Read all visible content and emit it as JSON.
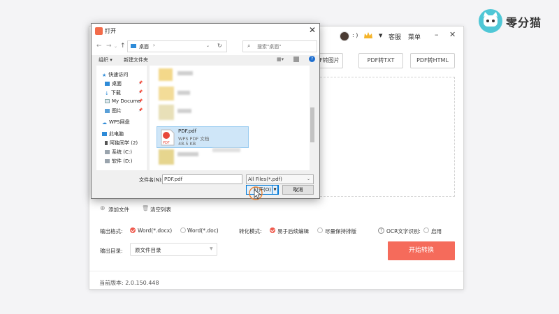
{
  "brand": {
    "name": "零分猫"
  },
  "app": {
    "user_smile": ": )",
    "support_label": "客服",
    "menu_label": "菜单",
    "formats": [
      "PDF转图片",
      "PDF转TXT",
      "PDF转HTML"
    ],
    "add_file_label": "添加文件",
    "clear_list_label": "清空列表",
    "output_format_label": "输出格式:",
    "output_formats": [
      {
        "label": "Word(*.docx)",
        "checked": true
      },
      {
        "label": "Word(*.doc)",
        "checked": false
      }
    ],
    "convert_mode_label": "转化模式:",
    "convert_modes": [
      {
        "label": "易于后续编辑",
        "checked": true
      },
      {
        "label": "尽量保持排版",
        "checked": false
      }
    ],
    "ocr_label": "OCR文字识别:",
    "ocr_option": "启用",
    "output_dir_label": "输出目录:",
    "output_dir_value": "原文件目录",
    "start_label": "开始转换",
    "version": "当前版本: 2.0.150.448",
    "accent": "#f56b5b"
  },
  "dialog": {
    "title": "打开",
    "address": "桌面",
    "search_placeholder": "搜索\"桌面\"",
    "organize": "组织 ▾",
    "new_folder": "新建文件夹",
    "tree": [
      {
        "label": "快速访问",
        "icon": "star-icon"
      },
      {
        "label": "桌面",
        "icon": "desktop-icon"
      },
      {
        "label": "下载",
        "icon": "download-icon"
      },
      {
        "label": "My Docume",
        "icon": "document-icon"
      },
      {
        "label": "图片",
        "icon": "picture-icon"
      },
      {
        "label": "WPS网盘",
        "icon": "cloud-icon"
      },
      {
        "label": "此电脑",
        "icon": "computer-icon"
      },
      {
        "label": "阿独同学 (2)",
        "icon": "phone-icon"
      },
      {
        "label": "系统 (C:)",
        "icon": "drive-icon"
      },
      {
        "label": "软件 (D:)",
        "icon": "drive-icon"
      }
    ],
    "selected_file": {
      "name": "PDF.pdf",
      "type": "WPS PDF 文档",
      "size": "48.5 KB"
    },
    "filename_label": "文件名(N):",
    "filename_value": "PDF.pdf",
    "filter_value": "All Files(*.pdf)",
    "open_label": "打开(O)",
    "cancel_label": "取消"
  }
}
